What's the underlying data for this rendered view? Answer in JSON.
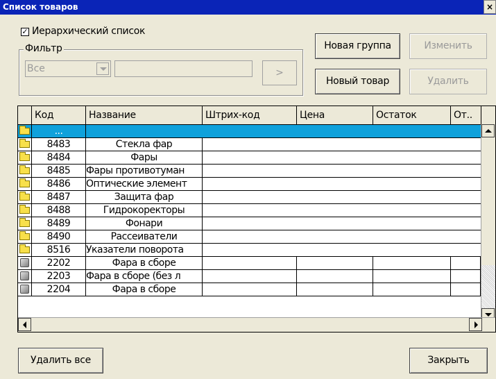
{
  "window": {
    "title": "Список товаров",
    "close_label": "×"
  },
  "hier_checkbox": {
    "label": "Иерархический список",
    "checked": "☑"
  },
  "filter": {
    "legend": "Фильтр",
    "selected": "Все",
    "go_label": ">"
  },
  "buttons": {
    "new_group": "Новая группа",
    "edit": "Изменить",
    "new_item": "Новый товар",
    "delete": "Удалить",
    "delete_all": "Удалить все",
    "close": "Закрыть"
  },
  "grid": {
    "columns": [
      "Код",
      "Название",
      "Штрих-код",
      "Цена",
      "Остаток",
      "От.."
    ],
    "rows": [
      {
        "type": "folder",
        "code": "...",
        "name": "",
        "selected": true
      },
      {
        "type": "folder",
        "code": "8483",
        "name": "Стекла фар"
      },
      {
        "type": "folder",
        "code": "8484",
        "name": "Фары"
      },
      {
        "type": "folder",
        "code": "8485",
        "name": "Фары противотуман"
      },
      {
        "type": "folder",
        "code": "8486",
        "name": "Оптические элемент"
      },
      {
        "type": "folder",
        "code": "8487",
        "name": "Защита фар"
      },
      {
        "type": "folder",
        "code": "8488",
        "name": "Гидрокоректоры"
      },
      {
        "type": "folder",
        "code": "8489",
        "name": "Фонари"
      },
      {
        "type": "folder",
        "code": "8490",
        "name": "Рассеиватели"
      },
      {
        "type": "folder",
        "code": "8516",
        "name": "Указатели поворота"
      },
      {
        "type": "item",
        "code": "2202",
        "name": "Фара в сборе"
      },
      {
        "type": "item",
        "code": "2203",
        "name": "Фара в сборе (без л"
      },
      {
        "type": "item",
        "code": "2204",
        "name": "Фара в сборе"
      }
    ]
  },
  "colors": {
    "titlebar": "#0a24b7",
    "selection": "#0fa1db",
    "folder": "#f8e04a"
  }
}
